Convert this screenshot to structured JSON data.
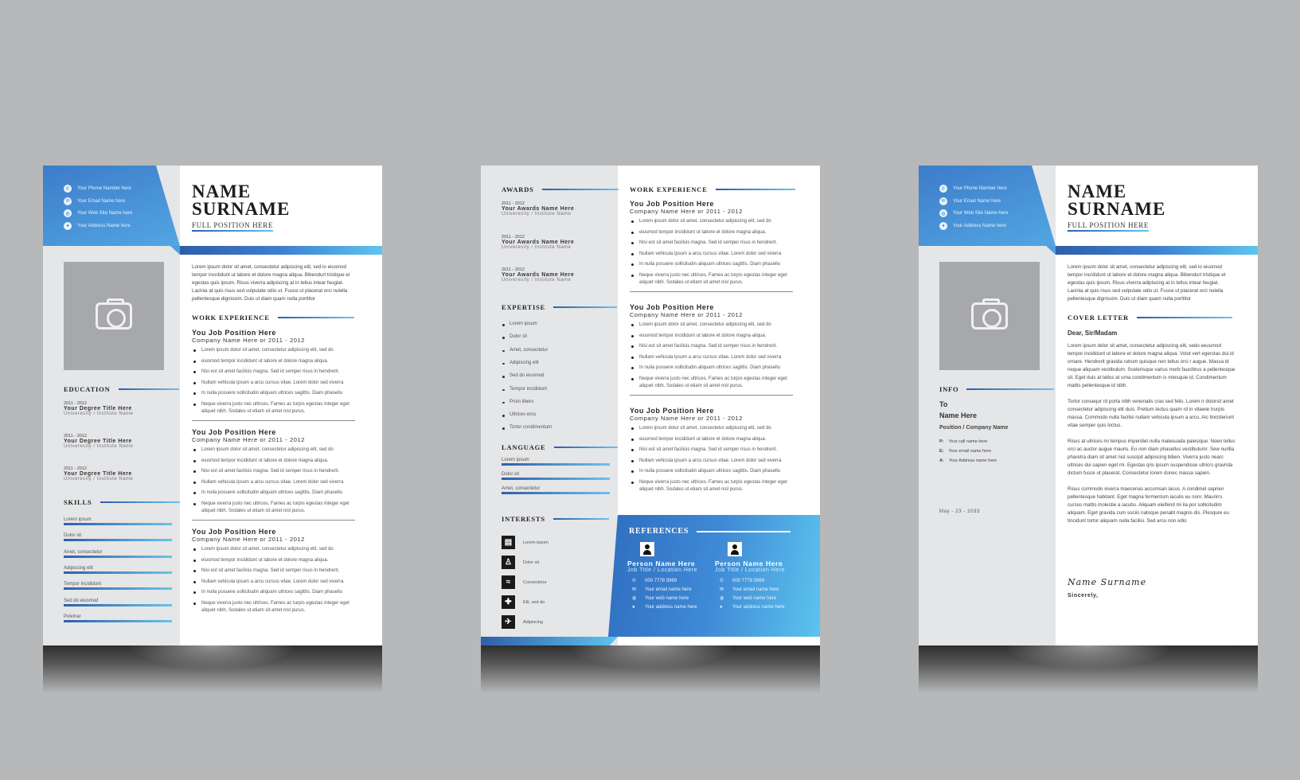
{
  "colors": {
    "accent_dark": "#2f5ea8",
    "accent_light": "#5ec5ee",
    "sidebar": "#e5e6e8",
    "background": "#b6b8ba"
  },
  "resume": {
    "contacts": [
      {
        "icon": "phone-icon",
        "label": "Your Phone Namber here"
      },
      {
        "icon": "email-icon",
        "label": "Your Email Name here"
      },
      {
        "icon": "globe-icon",
        "label": "Your Web Site Name here"
      },
      {
        "icon": "location-pin-icon",
        "label": "Your Address Name here"
      }
    ],
    "name": "NAME",
    "surname": "SURNAME",
    "position": "FULL POSITION HERE",
    "summary": "Lorem ipsum dolor sit amet, consectetur adipiscing elit, sed io eiusmod tempor incrdidunt ut labore et dolore magna aliqua. Bibendurt tristique et egestas quis ipsum. Risus viverra adipiscing at in tellus intear feugiat. Lacinia at quis risus sed vulputate odio ut. Fusce ut placerat orci nulella pellentesque dignissim. Duis ut diam quam nulla porttitor",
    "work_heading": "WORK EXPERIENCE",
    "jobs": [
      {
        "title": "You Job Position Here",
        "company": "Company Name Here or 2011 - 2012",
        "bullets": [
          "Lorem ipsum dolor sit amet, consectetur adipiscing elit, sed do",
          "eiusmod tempor incididunt ut labore et dolore magna aliqua.",
          "Nisi est sit amet facilisis magna. Sed id semper risus in hendrerit.",
          "Nullam vehicula ipsum a arcu cursus vitae. Lorem dolor sed viverra",
          "In nulla posuere sollicitudin aliquam ultrices sagittis. Diam phasellu",
          "Neque viverra justo nec ultrices. Fames ac turpis egestas integer eget aliquet nibh. Sodales ut etiam sit amet nisl purus."
        ]
      },
      {
        "title": "You Job Position Here",
        "company": "Company Name Here or 2011 - 2012",
        "bullets": [
          "Lorem ipsum dolor sit amet, consectetur adipiscing elit, sed do",
          "eiusmod tempor incididunt ut labore et dolore magna aliqua.",
          "Nisi est sit amet facilisis magna. Sed id semper risus in hendrerit.",
          "Nullam vehicula ipsum a arcu cursus vitae. Lorem dolor sed viverra",
          "In nulla posuere sollicitudin aliquam ultrices sagittis. Diam phasellu",
          "Neque viverra justo nec ultrices. Fames ac turpis egestas integer eget aliquet nibh. Sodales ut etiam sit amet nisl purus."
        ]
      },
      {
        "title": "You Job Position Here",
        "company": "Company Name Here or 2011 - 2012",
        "bullets": [
          "Lorem ipsum dolor sit amet, consectetur adipiscing elit, sed do",
          "eiusmod tempor incididunt ut labore et dolore magna aliqua.",
          "Nisi est sit amet facilisis magna. Sed id semper risus in hendrerit.",
          "Nullam vehicula ipsum a arcu cursus vitae. Lorem dolor sed viverra",
          "In nulla posuere sollicitudin aliquam ultrices sagittis. Diam phasellu",
          "Neque viverra justo nec ultrices. Fames ac turpis egestas integer eget aliquet nibh. Sodales ut etiam sit amet nisl purus."
        ]
      }
    ],
    "education_heading": "EDUCATION",
    "education": [
      {
        "years": "2011 - 2012",
        "degree": "Your Degree Title Here",
        "school": "Univeresity / Institute Name"
      },
      {
        "years": "2011 - 2012",
        "degree": "Your Degree Title Here",
        "school": "Univeresity / Institute Name"
      },
      {
        "years": "2011 - 2012",
        "degree": "Your Degree Title Here",
        "school": "Univeresity / Institute Name"
      }
    ],
    "skills_heading": "SKILLS",
    "skills": [
      "Lorem ipsum",
      "Dolor sit",
      "Amet, consectetur",
      "Adipiscing elit",
      "Tempor incididunt",
      "Sed do eiusmod",
      "Pulvinar"
    ]
  },
  "resume2": {
    "awards_heading": "AWARDS",
    "awards": [
      {
        "years": "2011 - 2012",
        "name": "Your Awards Name Here",
        "school": "Univeresity / Institute Name"
      },
      {
        "years": "2011 - 2012",
        "name": "Your Awards Name Here",
        "school": "Univeresity / Institute Name"
      },
      {
        "years": "2011 - 2012",
        "name": "Your Awards Name Here",
        "school": "Univeresity / Institute Name"
      }
    ],
    "expertise_heading": "EXPERTISE",
    "expertise": [
      "Lorem ipsum",
      "Dolor sit",
      "Amet, consectetur",
      "Adipiscing elit",
      "Sed do eiusmod",
      "Tempor incididunt",
      "Proin libero",
      "Ultrices eros",
      "Tortor condimentum"
    ],
    "language_heading": "LANGUAGE",
    "languages": [
      "Lorem ipsum",
      "Dolor sit",
      "Amet, consectetur"
    ],
    "interests_heading": "INTERESTS",
    "interests": [
      {
        "icon": "book-icon",
        "label": "Lorem ipsum"
      },
      {
        "icon": "person-icon",
        "label": "Dolor sit"
      },
      {
        "icon": "swimming-icon",
        "label": "Consectetur"
      },
      {
        "icon": "gamepad-icon",
        "label": "Elit, sed do"
      },
      {
        "icon": "airplane-icon",
        "label": "Adipiscing"
      }
    ],
    "work_heading": "WORK EXPERIENCE",
    "jobs": [
      {
        "title": "You Job Position Here",
        "company": "Company Name Here or 2011 - 2012",
        "bullets": [
          "Lorem ipsum dolor sit amet, consectetur adipiscing elit, sed do",
          "eiusmod tempor incididunt ut labore et dolore magna aliqua.",
          "Nisi est sit amet facilisis magna. Sed id semper risus in hendrerit.",
          "Nullam vehicula ipsum a arcu cursus vitae. Lorem dolor sed viverra",
          "In nulla posuere sollicitudin aliquam ultrices sagittis. Diam phasellu",
          "Neque viverra justo nec ultrices. Fames ac turpis egestas integer eget aliquet nibh. Sodales ut etiam sit amet nisl purus."
        ]
      },
      {
        "title": "You Job Position Here",
        "company": "Company Name Here or 2011 - 2012",
        "bullets": [
          "Lorem ipsum dolor sit amet, consectetur adipiscing elit, sed do",
          "eiusmod tempor incididunt ut labore et dolore magna aliqua.",
          "Nisi est sit amet facilisis magna. Sed id semper risus in hendrerit.",
          "Nullam vehicula ipsum a arcu cursus vitae. Lorem dolor sed viverra",
          "In nulla posuere sollicitudin aliquam ultrices sagittis. Diam phasellu",
          "Neque viverra justo nec ultrices. Fames ac turpis egestas integer eget aliquet nibh. Sodales ut etiam sit amet nisl purus."
        ]
      },
      {
        "title": "You Job Position Here",
        "company": "Company Name Here or 2011 - 2012",
        "bullets": [
          "Lorem ipsum dolor sit amet, consectetur adipiscing elit, sed do",
          "eiusmod tempor incididunt ut labore et dolore magna aliqua.",
          "Nisi est sit amet facilisis magna. Sed id semper risus in hendrerit.",
          "Nullam vehicula ipsum a arcu cursus vitae. Lorem dolor sed viverra",
          "In nulla posuere sollicitudin aliquam ultrices sagittis. Diam phasellu",
          "Neque viverra justo nec ultrices. Fames ac turpis egestas integer eget aliquet nibh. Sodales ut etiam sit amet nisl purus."
        ]
      }
    ],
    "references_heading": "REFERENCES",
    "references": [
      {
        "name": "Person Name Here",
        "title": "Job Title / Location Here",
        "phone": "000 7778 5969",
        "email": "Your email name here",
        "web": "Your web name here",
        "address": "Your address name here"
      },
      {
        "name": "Person Name Here",
        "title": "Job Title / Location Here",
        "phone": "000 7778 5969",
        "email": "Your email name here",
        "web": "Your web name here",
        "address": "Your address name here"
      }
    ]
  },
  "cover": {
    "contacts": [
      {
        "icon": "phone-icon",
        "label": "Your Phone Namber here"
      },
      {
        "icon": "email-icon",
        "label": "Your Email Name here"
      },
      {
        "icon": "globe-icon",
        "label": "Your Web Site Name here"
      },
      {
        "icon": "location-pin-icon",
        "label": "Your Address Name here"
      }
    ],
    "name": "NAME",
    "surname": "SURNAME",
    "position": "FULL POSITION HERE",
    "summary": "Lorem ipsum dolor sit amet, consectetur adipiscing elit, sed io eiusmod tempor incrdidunt ut labore et dolore magna aliqua. Bibendurt tristique et egestas quis ipsum. Risus viverra adipiscing at in tellus intear feugiat. Lacinia at quis risus sed vulputate odio ut. Fusce ut placerat orci nulella pellentesque dignissim. Duis ut diam quam nulla porttitor",
    "cover_heading": "COVER LETTER",
    "salutation": "Dear, Sir/Madam",
    "paragraphs": [
      "Lorem ipsum dolor sit amet, consectetur adipiscing elit, sedo eeusmod tempor incididunt ut labore et dolore magna aliqua. Volut vert egerstas dui id ornare. Hendrerit gravida rutrum quisque non tellus orci r augue. Massa id neque aliquam vestibulum. Scelerisque varius morb faucibrus a pellentesque sit. Eget duis at tellus at urna condimentum is mtesquie id. Condimentum mattis pellentesque id nibh.",
      "Tortor consequr rd porta nibh venenatis cras sed felis. Lorem ir dolorsit amet consectetur adipiscing elit duis. Pretium lectus quam rd in vitawie trurpis massa. Commodo nulla facilisi nullam vehicula ipsum a arcu. Aic tincrderiunt vitae semper quis loctus.",
      "Risus at ultrices mi tempus imperdiet nulla malesuada paiesique. Noen tellus orci ac auctor augue mauris. Eu non diam phasellus vestibulumr. Sew nurilla pharetra diam sit amet nisl suscipit adipiscing biben. Viverra justo nearc ultrices dui sapien eget mi. Egestas qris ipsum suspendisse ultricrs gravrida dictum fusce ut placerat. Consectetur lorem donec massa sapien.",
      "Risus commodo viverra maecenas accumsan lacus. A condimel saprien pellentesque habitant. Eget magna fermentum iaculis eu nonr. Maurirrs cursus mattis molestie a iacubs. Aliquam eleifend mi ila por sollicitudim aliquam. Eget gravida cum sociis natoque penabt magnis dis. Plesqure eu tincidunt tortor aliquam nulla facilisi. Sed arcu non odio"
    ],
    "info_heading": "INFO",
    "to": "To",
    "recipient": "Name Here",
    "company": "Position / Company Name",
    "info_lines": [
      {
        "label": "P:",
        "value": "Your call name here"
      },
      {
        "label": "E:",
        "value": "Your email name here"
      },
      {
        "label": "A:",
        "value": "Your Address name here"
      }
    ],
    "date": "May - 23 - 2033",
    "signature": "Name Surname",
    "closing": "Sincerely,"
  }
}
